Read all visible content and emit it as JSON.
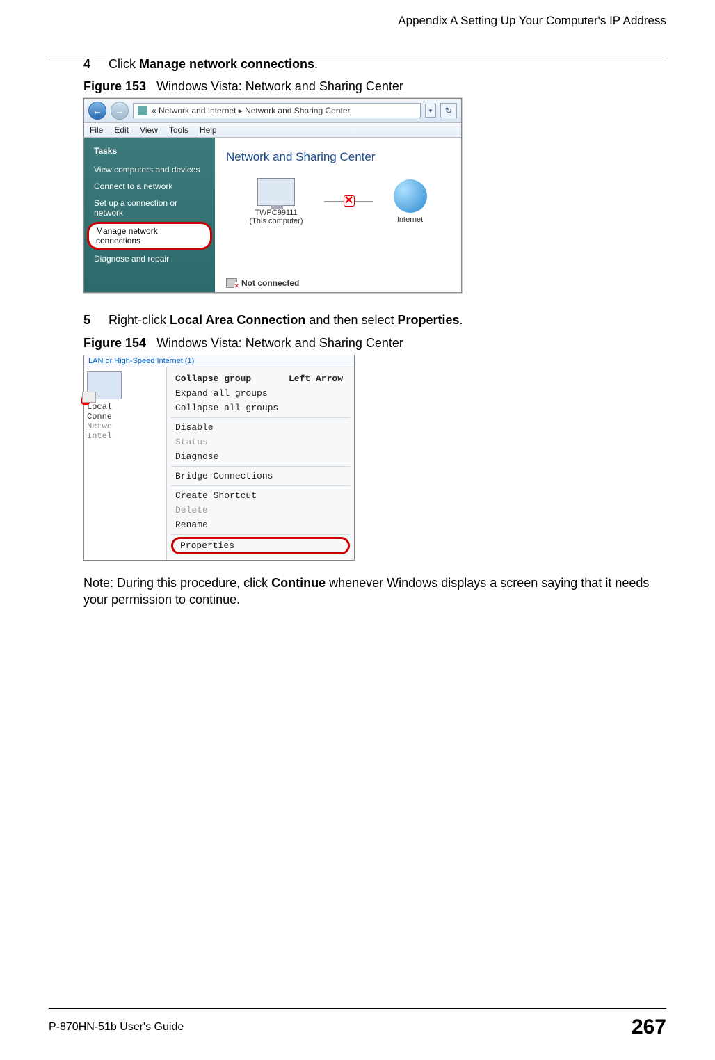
{
  "header": {
    "appendix": "Appendix A Setting Up Your Computer's IP Address"
  },
  "steps": {
    "s4": {
      "num": "4",
      "text_a": "Click ",
      "bold": "Manage network connections",
      "text_b": "."
    },
    "s5": {
      "num": "5",
      "text_a": "Right-click ",
      "bold1": "Local Area Connection",
      "mid": " and then select ",
      "bold2": "Properties",
      "text_b": "."
    }
  },
  "figures": {
    "f153": {
      "label": "Figure 153",
      "caption": "Windows Vista: Network and Sharing Center"
    },
    "f154": {
      "label": "Figure 154",
      "caption": "Windows Vista: Network and Sharing Center"
    }
  },
  "win1": {
    "breadcrumb": "« Network and Internet ▸ Network and Sharing Center",
    "menu": {
      "file": "File",
      "edit": "Edit",
      "view": "View",
      "tools": "Tools",
      "help": "Help"
    },
    "sidebar": {
      "hdr": "Tasks",
      "t1": "View computers and devices",
      "t2": "Connect to a network",
      "t3": "Set up a connection or network",
      "t4": "Manage network connections",
      "t5": "Diagnose and repair"
    },
    "main": {
      "title": "Network and Sharing Center",
      "node1a": "TWPC99111",
      "node1b": "(This computer)",
      "node2": "Internet",
      "status": "Not connected"
    }
  },
  "win2": {
    "top": "LAN or High-Speed Internet (1)",
    "left": {
      "l1": "Local",
      "l2": "Conne",
      "l3": "Netwo",
      "l4": "Intel"
    },
    "ctx": {
      "r1a": "Collapse group",
      "r1b": "Left Arrow",
      "r2": "Expand all groups",
      "r3": "Collapse all groups",
      "r4": "Disable",
      "r5": "Status",
      "r6": "Diagnose",
      "r7": "Bridge Connections",
      "r8": "Create Shortcut",
      "r9": "Delete",
      "r10": "Rename",
      "r11": "Properties"
    }
  },
  "note": {
    "prefix": "Note: During this procedure, click ",
    "bold": "Continue",
    "suffix": " whenever Windows displays a screen saying that it needs your permission to continue."
  },
  "footer": {
    "guide": "P-870HN-51b User's Guide",
    "page": "267"
  }
}
